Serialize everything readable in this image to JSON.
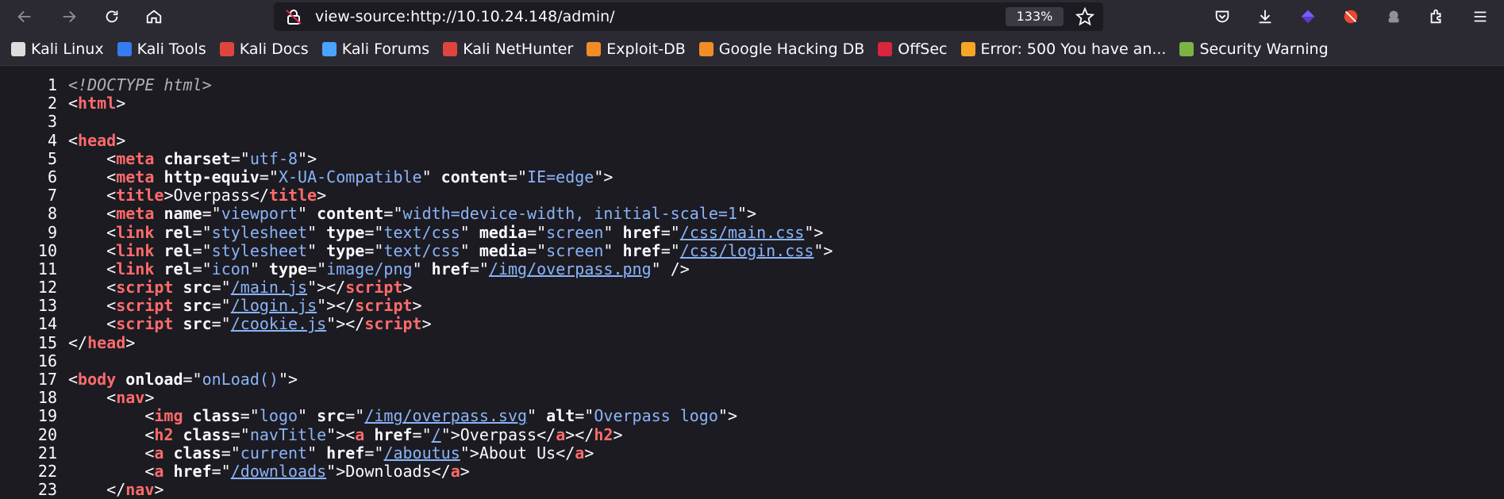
{
  "browser": {
    "url": "view-source:http://10.10.24.148/admin/",
    "zoom": "133%",
    "toolbar_icons": [
      "back-icon",
      "forward-icon",
      "reload-icon",
      "home-icon",
      "pocket-icon",
      "download-icon",
      "extension-icon",
      "extension-icon",
      "extension-icon",
      "extensions-icon",
      "menu-icon"
    ]
  },
  "bookmarks": [
    {
      "label": "Kali Linux",
      "color": "#dddddd"
    },
    {
      "label": "Kali Tools",
      "color": "#367bf0"
    },
    {
      "label": "Kali Docs",
      "color": "#e0443e"
    },
    {
      "label": "Kali Forums",
      "color": "#4aa3ff"
    },
    {
      "label": "Kali NetHunter",
      "color": "#e0443e"
    },
    {
      "label": "Exploit-DB",
      "color": "#f28c28"
    },
    {
      "label": "Google Hacking DB",
      "color": "#f28c28"
    },
    {
      "label": "OffSec",
      "color": "#d7263d"
    },
    {
      "label": "Error: 500 You have an...",
      "color": "#f5a623"
    },
    {
      "label": "Security Warning",
      "color": "#7cb342"
    }
  ],
  "source_lines": [
    [
      [
        "doctype",
        "<!DOCTYPE html>"
      ]
    ],
    [
      [
        "code",
        "<"
      ],
      [
        "tag",
        "html"
      ],
      [
        "code",
        ">"
      ]
    ],
    [],
    [
      [
        "code",
        "<"
      ],
      [
        "tag",
        "head"
      ],
      [
        "code",
        ">"
      ]
    ],
    [
      [
        "code",
        "    <"
      ],
      [
        "tag",
        "meta"
      ],
      [
        "code",
        " "
      ],
      [
        "attr",
        "charset"
      ],
      [
        "code",
        "=\""
      ],
      [
        "val",
        "utf-8"
      ],
      [
        "code",
        "\">"
      ]
    ],
    [
      [
        "code",
        "    <"
      ],
      [
        "tag",
        "meta"
      ],
      [
        "code",
        " "
      ],
      [
        "attr",
        "http-equiv"
      ],
      [
        "code",
        "=\""
      ],
      [
        "val",
        "X-UA-Compatible"
      ],
      [
        "code",
        "\" "
      ],
      [
        "attr",
        "content"
      ],
      [
        "code",
        "=\""
      ],
      [
        "val",
        "IE=edge"
      ],
      [
        "code",
        "\">"
      ]
    ],
    [
      [
        "code",
        "    <"
      ],
      [
        "tag",
        "title"
      ],
      [
        "code",
        ">Overpass</"
      ],
      [
        "tag",
        "title"
      ],
      [
        "code",
        ">"
      ]
    ],
    [
      [
        "code",
        "    <"
      ],
      [
        "tag",
        "meta"
      ],
      [
        "code",
        " "
      ],
      [
        "attr",
        "name"
      ],
      [
        "code",
        "=\""
      ],
      [
        "val",
        "viewport"
      ],
      [
        "code",
        "\" "
      ],
      [
        "attr",
        "content"
      ],
      [
        "code",
        "=\""
      ],
      [
        "val",
        "width=device-width, initial-scale=1"
      ],
      [
        "code",
        "\">"
      ]
    ],
    [
      [
        "code",
        "    <"
      ],
      [
        "tag",
        "link"
      ],
      [
        "code",
        " "
      ],
      [
        "attr",
        "rel"
      ],
      [
        "code",
        "=\""
      ],
      [
        "val",
        "stylesheet"
      ],
      [
        "code",
        "\" "
      ],
      [
        "attr",
        "type"
      ],
      [
        "code",
        "=\""
      ],
      [
        "val",
        "text/css"
      ],
      [
        "code",
        "\" "
      ],
      [
        "attr",
        "media"
      ],
      [
        "code",
        "=\""
      ],
      [
        "val",
        "screen"
      ],
      [
        "code",
        "\" "
      ],
      [
        "attr",
        "href"
      ],
      [
        "code",
        "=\""
      ],
      [
        "link",
        "/css/main.css"
      ],
      [
        "code",
        "\">"
      ]
    ],
    [
      [
        "code",
        "    <"
      ],
      [
        "tag",
        "link"
      ],
      [
        "code",
        " "
      ],
      [
        "attr",
        "rel"
      ],
      [
        "code",
        "=\""
      ],
      [
        "val",
        "stylesheet"
      ],
      [
        "code",
        "\" "
      ],
      [
        "attr",
        "type"
      ],
      [
        "code",
        "=\""
      ],
      [
        "val",
        "text/css"
      ],
      [
        "code",
        "\" "
      ],
      [
        "attr",
        "media"
      ],
      [
        "code",
        "=\""
      ],
      [
        "val",
        "screen"
      ],
      [
        "code",
        "\" "
      ],
      [
        "attr",
        "href"
      ],
      [
        "code",
        "=\""
      ],
      [
        "link",
        "/css/login.css"
      ],
      [
        "code",
        "\">"
      ]
    ],
    [
      [
        "code",
        "    <"
      ],
      [
        "tag",
        "link"
      ],
      [
        "code",
        " "
      ],
      [
        "attr",
        "rel"
      ],
      [
        "code",
        "=\""
      ],
      [
        "val",
        "icon"
      ],
      [
        "code",
        "\" "
      ],
      [
        "attr",
        "type"
      ],
      [
        "code",
        "=\""
      ],
      [
        "val",
        "image/png"
      ],
      [
        "code",
        "\" "
      ],
      [
        "attr",
        "href"
      ],
      [
        "code",
        "=\""
      ],
      [
        "link",
        "/img/overpass.png"
      ],
      [
        "code",
        "\" />"
      ]
    ],
    [
      [
        "code",
        "    <"
      ],
      [
        "tag",
        "script"
      ],
      [
        "code",
        " "
      ],
      [
        "attr",
        "src"
      ],
      [
        "code",
        "=\""
      ],
      [
        "link",
        "/main.js"
      ],
      [
        "code",
        "\"></"
      ],
      [
        "tag",
        "script"
      ],
      [
        "code",
        ">"
      ]
    ],
    [
      [
        "code",
        "    <"
      ],
      [
        "tag",
        "script"
      ],
      [
        "code",
        " "
      ],
      [
        "attr",
        "src"
      ],
      [
        "code",
        "=\""
      ],
      [
        "link",
        "/login.js"
      ],
      [
        "code",
        "\"></"
      ],
      [
        "tag",
        "script"
      ],
      [
        "code",
        ">"
      ]
    ],
    [
      [
        "code",
        "    <"
      ],
      [
        "tag",
        "script"
      ],
      [
        "code",
        " "
      ],
      [
        "attr",
        "src"
      ],
      [
        "code",
        "=\""
      ],
      [
        "link",
        "/cookie.js"
      ],
      [
        "code",
        "\"></"
      ],
      [
        "tag",
        "script"
      ],
      [
        "code",
        ">"
      ]
    ],
    [
      [
        "code",
        "</"
      ],
      [
        "tag",
        "head"
      ],
      [
        "code",
        ">"
      ]
    ],
    [],
    [
      [
        "code",
        "<"
      ],
      [
        "tag",
        "body"
      ],
      [
        "code",
        " "
      ],
      [
        "attr",
        "onload"
      ],
      [
        "code",
        "=\""
      ],
      [
        "val",
        "onLoad()"
      ],
      [
        "code",
        "\">"
      ]
    ],
    [
      [
        "code",
        "    <"
      ],
      [
        "tag",
        "nav"
      ],
      [
        "code",
        ">"
      ]
    ],
    [
      [
        "code",
        "        <"
      ],
      [
        "tag",
        "img"
      ],
      [
        "code",
        " "
      ],
      [
        "attr",
        "class"
      ],
      [
        "code",
        "=\""
      ],
      [
        "val",
        "logo"
      ],
      [
        "code",
        "\" "
      ],
      [
        "attr",
        "src"
      ],
      [
        "code",
        "=\""
      ],
      [
        "link",
        "/img/overpass.svg"
      ],
      [
        "code",
        "\" "
      ],
      [
        "attr",
        "alt"
      ],
      [
        "code",
        "=\""
      ],
      [
        "val",
        "Overpass logo"
      ],
      [
        "code",
        "\">"
      ]
    ],
    [
      [
        "code",
        "        <"
      ],
      [
        "tag",
        "h2"
      ],
      [
        "code",
        " "
      ],
      [
        "attr",
        "class"
      ],
      [
        "code",
        "=\""
      ],
      [
        "val",
        "navTitle"
      ],
      [
        "code",
        "\"><"
      ],
      [
        "tag",
        "a"
      ],
      [
        "code",
        " "
      ],
      [
        "attr",
        "href"
      ],
      [
        "code",
        "=\""
      ],
      [
        "link",
        "/"
      ],
      [
        "code",
        "\">Overpass</"
      ],
      [
        "tag",
        "a"
      ],
      [
        "code",
        "></"
      ],
      [
        "tag",
        "h2"
      ],
      [
        "code",
        ">"
      ]
    ],
    [
      [
        "code",
        "        <"
      ],
      [
        "tag",
        "a"
      ],
      [
        "code",
        " "
      ],
      [
        "attr",
        "class"
      ],
      [
        "code",
        "=\""
      ],
      [
        "val",
        "current"
      ],
      [
        "code",
        "\" "
      ],
      [
        "attr",
        "href"
      ],
      [
        "code",
        "=\""
      ],
      [
        "link",
        "/aboutus"
      ],
      [
        "code",
        "\">About Us</"
      ],
      [
        "tag",
        "a"
      ],
      [
        "code",
        ">"
      ]
    ],
    [
      [
        "code",
        "        <"
      ],
      [
        "tag",
        "a"
      ],
      [
        "code",
        " "
      ],
      [
        "attr",
        "href"
      ],
      [
        "code",
        "=\""
      ],
      [
        "link",
        "/downloads"
      ],
      [
        "code",
        "\">Downloads</"
      ],
      [
        "tag",
        "a"
      ],
      [
        "code",
        ">"
      ]
    ],
    [
      [
        "code",
        "    </"
      ],
      [
        "tag",
        "nav"
      ],
      [
        "code",
        ">"
      ]
    ]
  ]
}
